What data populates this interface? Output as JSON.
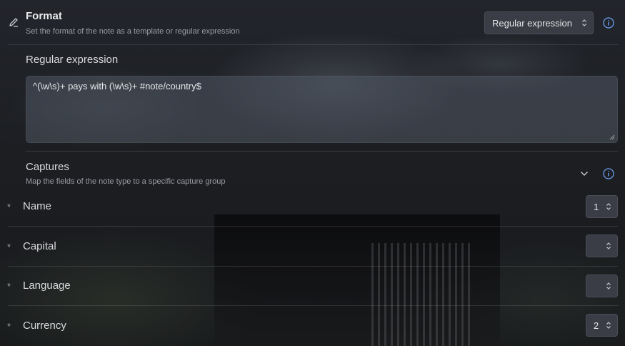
{
  "format": {
    "title": "Format",
    "description": "Set the format of the note as a template or regular expression",
    "selected": "Regular expression"
  },
  "regex": {
    "label": "Regular expression",
    "value": "^(\\w\\s)+ pays with (\\w\\s)+ #note/country$"
  },
  "captures": {
    "title": "Captures",
    "description": "Map the fields of the note type to a specific capture group"
  },
  "fields": [
    {
      "name": "Name",
      "required": "*",
      "value": "1"
    },
    {
      "name": "Capital",
      "required": "*",
      "value": ""
    },
    {
      "name": "Language",
      "required": "*",
      "value": ""
    },
    {
      "name": "Currency",
      "required": "*",
      "value": "2"
    }
  ],
  "colors": {
    "accent": "#6b9ef0"
  },
  "icons": [
    "edit-icon",
    "info-icon",
    "chevron-down-icon",
    "updown-chevron-icon",
    "resize-grip-icon"
  ]
}
